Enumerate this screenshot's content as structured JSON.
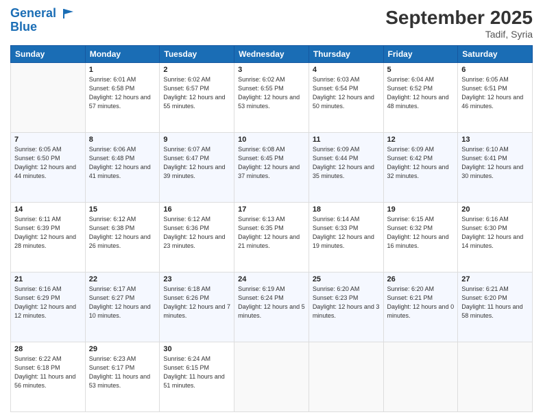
{
  "header": {
    "logo_line1": "General",
    "logo_line2": "Blue",
    "month_title": "September 2025",
    "location": "Tadif, Syria"
  },
  "weekdays": [
    "Sunday",
    "Monday",
    "Tuesday",
    "Wednesday",
    "Thursday",
    "Friday",
    "Saturday"
  ],
  "weeks": [
    [
      {
        "day": "",
        "sunrise": "",
        "sunset": "",
        "daylight": ""
      },
      {
        "day": "1",
        "sunrise": "Sunrise: 6:01 AM",
        "sunset": "Sunset: 6:58 PM",
        "daylight": "Daylight: 12 hours and 57 minutes."
      },
      {
        "day": "2",
        "sunrise": "Sunrise: 6:02 AM",
        "sunset": "Sunset: 6:57 PM",
        "daylight": "Daylight: 12 hours and 55 minutes."
      },
      {
        "day": "3",
        "sunrise": "Sunrise: 6:02 AM",
        "sunset": "Sunset: 6:55 PM",
        "daylight": "Daylight: 12 hours and 53 minutes."
      },
      {
        "day": "4",
        "sunrise": "Sunrise: 6:03 AM",
        "sunset": "Sunset: 6:54 PM",
        "daylight": "Daylight: 12 hours and 50 minutes."
      },
      {
        "day": "5",
        "sunrise": "Sunrise: 6:04 AM",
        "sunset": "Sunset: 6:52 PM",
        "daylight": "Daylight: 12 hours and 48 minutes."
      },
      {
        "day": "6",
        "sunrise": "Sunrise: 6:05 AM",
        "sunset": "Sunset: 6:51 PM",
        "daylight": "Daylight: 12 hours and 46 minutes."
      }
    ],
    [
      {
        "day": "7",
        "sunrise": "Sunrise: 6:05 AM",
        "sunset": "Sunset: 6:50 PM",
        "daylight": "Daylight: 12 hours and 44 minutes."
      },
      {
        "day": "8",
        "sunrise": "Sunrise: 6:06 AM",
        "sunset": "Sunset: 6:48 PM",
        "daylight": "Daylight: 12 hours and 41 minutes."
      },
      {
        "day": "9",
        "sunrise": "Sunrise: 6:07 AM",
        "sunset": "Sunset: 6:47 PM",
        "daylight": "Daylight: 12 hours and 39 minutes."
      },
      {
        "day": "10",
        "sunrise": "Sunrise: 6:08 AM",
        "sunset": "Sunset: 6:45 PM",
        "daylight": "Daylight: 12 hours and 37 minutes."
      },
      {
        "day": "11",
        "sunrise": "Sunrise: 6:09 AM",
        "sunset": "Sunset: 6:44 PM",
        "daylight": "Daylight: 12 hours and 35 minutes."
      },
      {
        "day": "12",
        "sunrise": "Sunrise: 6:09 AM",
        "sunset": "Sunset: 6:42 PM",
        "daylight": "Daylight: 12 hours and 32 minutes."
      },
      {
        "day": "13",
        "sunrise": "Sunrise: 6:10 AM",
        "sunset": "Sunset: 6:41 PM",
        "daylight": "Daylight: 12 hours and 30 minutes."
      }
    ],
    [
      {
        "day": "14",
        "sunrise": "Sunrise: 6:11 AM",
        "sunset": "Sunset: 6:39 PM",
        "daylight": "Daylight: 12 hours and 28 minutes."
      },
      {
        "day": "15",
        "sunrise": "Sunrise: 6:12 AM",
        "sunset": "Sunset: 6:38 PM",
        "daylight": "Daylight: 12 hours and 26 minutes."
      },
      {
        "day": "16",
        "sunrise": "Sunrise: 6:12 AM",
        "sunset": "Sunset: 6:36 PM",
        "daylight": "Daylight: 12 hours and 23 minutes."
      },
      {
        "day": "17",
        "sunrise": "Sunrise: 6:13 AM",
        "sunset": "Sunset: 6:35 PM",
        "daylight": "Daylight: 12 hours and 21 minutes."
      },
      {
        "day": "18",
        "sunrise": "Sunrise: 6:14 AM",
        "sunset": "Sunset: 6:33 PM",
        "daylight": "Daylight: 12 hours and 19 minutes."
      },
      {
        "day": "19",
        "sunrise": "Sunrise: 6:15 AM",
        "sunset": "Sunset: 6:32 PM",
        "daylight": "Daylight: 12 hours and 16 minutes."
      },
      {
        "day": "20",
        "sunrise": "Sunrise: 6:16 AM",
        "sunset": "Sunset: 6:30 PM",
        "daylight": "Daylight: 12 hours and 14 minutes."
      }
    ],
    [
      {
        "day": "21",
        "sunrise": "Sunrise: 6:16 AM",
        "sunset": "Sunset: 6:29 PM",
        "daylight": "Daylight: 12 hours and 12 minutes."
      },
      {
        "day": "22",
        "sunrise": "Sunrise: 6:17 AM",
        "sunset": "Sunset: 6:27 PM",
        "daylight": "Daylight: 12 hours and 10 minutes."
      },
      {
        "day": "23",
        "sunrise": "Sunrise: 6:18 AM",
        "sunset": "Sunset: 6:26 PM",
        "daylight": "Daylight: 12 hours and 7 minutes."
      },
      {
        "day": "24",
        "sunrise": "Sunrise: 6:19 AM",
        "sunset": "Sunset: 6:24 PM",
        "daylight": "Daylight: 12 hours and 5 minutes."
      },
      {
        "day": "25",
        "sunrise": "Sunrise: 6:20 AM",
        "sunset": "Sunset: 6:23 PM",
        "daylight": "Daylight: 12 hours and 3 minutes."
      },
      {
        "day": "26",
        "sunrise": "Sunrise: 6:20 AM",
        "sunset": "Sunset: 6:21 PM",
        "daylight": "Daylight: 12 hours and 0 minutes."
      },
      {
        "day": "27",
        "sunrise": "Sunrise: 6:21 AM",
        "sunset": "Sunset: 6:20 PM",
        "daylight": "Daylight: 11 hours and 58 minutes."
      }
    ],
    [
      {
        "day": "28",
        "sunrise": "Sunrise: 6:22 AM",
        "sunset": "Sunset: 6:18 PM",
        "daylight": "Daylight: 11 hours and 56 minutes."
      },
      {
        "day": "29",
        "sunrise": "Sunrise: 6:23 AM",
        "sunset": "Sunset: 6:17 PM",
        "daylight": "Daylight: 11 hours and 53 minutes."
      },
      {
        "day": "30",
        "sunrise": "Sunrise: 6:24 AM",
        "sunset": "Sunset: 6:15 PM",
        "daylight": "Daylight: 11 hours and 51 minutes."
      },
      {
        "day": "",
        "sunrise": "",
        "sunset": "",
        "daylight": ""
      },
      {
        "day": "",
        "sunrise": "",
        "sunset": "",
        "daylight": ""
      },
      {
        "day": "",
        "sunrise": "",
        "sunset": "",
        "daylight": ""
      },
      {
        "day": "",
        "sunrise": "",
        "sunset": "",
        "daylight": ""
      }
    ]
  ]
}
